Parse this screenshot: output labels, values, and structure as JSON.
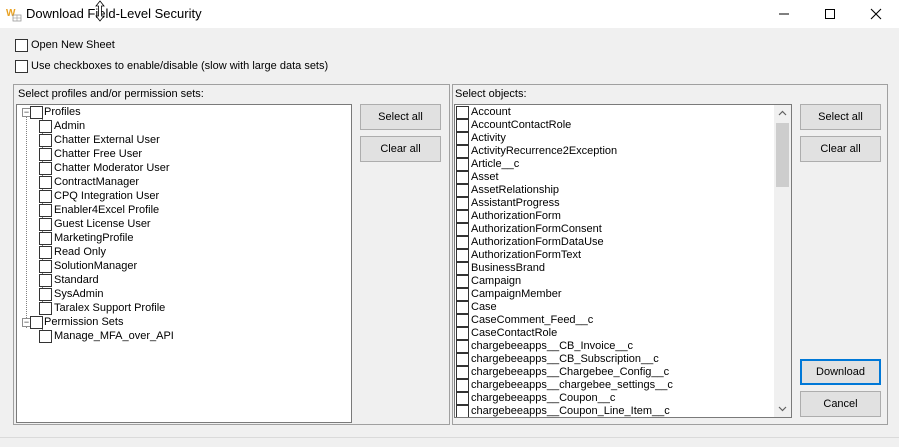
{
  "window": {
    "title": "Download Field-Level Security",
    "minimize_icon": "minimize-icon",
    "maximize_icon": "maximize-icon",
    "close_icon": "close-icon"
  },
  "options": {
    "open_new_sheet": "Open New Sheet",
    "use_checkboxes": "Use checkboxes to enable/disable (slow with large data sets)"
  },
  "profiles_panel": {
    "label": "Select profiles and/or permission sets:",
    "groups": [
      {
        "label": "Profiles",
        "items": [
          "Admin",
          "Chatter External User",
          "Chatter Free User",
          "Chatter Moderator User",
          "ContractManager",
          "CPQ Integration User",
          "Enabler4Excel Profile",
          "Guest License User",
          "MarketingProfile",
          "Read Only",
          "SolutionManager",
          "Standard",
          "SysAdmin",
          "Taralex Support Profile"
        ]
      },
      {
        "label": "Permission Sets",
        "items": [
          "Manage_MFA_over_API"
        ]
      }
    ],
    "select_all": "Select all",
    "clear_all": "Clear all"
  },
  "objects_panel": {
    "label": "Select objects:",
    "items": [
      "Account",
      "AccountContactRole",
      "Activity",
      "ActivityRecurrence2Exception",
      "Article__c",
      "Asset",
      "AssetRelationship",
      "AssistantProgress",
      "AuthorizationForm",
      "AuthorizationFormConsent",
      "AuthorizationFormDataUse",
      "AuthorizationFormText",
      "BusinessBrand",
      "Campaign",
      "CampaignMember",
      "Case",
      "CaseComment_Feed__c",
      "CaseContactRole",
      "chargebeeapps__CB_Invoice__c",
      "chargebeeapps__CB_Subscription__c",
      "chargebeeapps__Chargebee_Config__c",
      "chargebeeapps__chargebee_settings__c",
      "chargebeeapps__Coupon__c",
      "chargebeeapps__Coupon_Line_Item__c"
    ],
    "select_all": "Select all",
    "clear_all": "Clear all"
  },
  "actions": {
    "download": "Download",
    "cancel": "Cancel"
  },
  "colors": {
    "accent": "#0078d7",
    "window_bg": "#f0f0f0"
  }
}
